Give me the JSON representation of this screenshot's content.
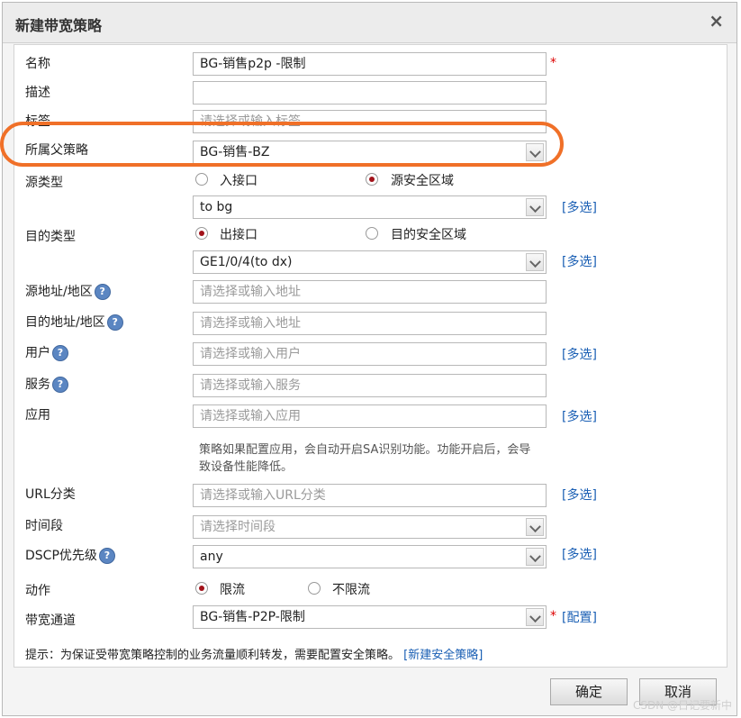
{
  "dialog": {
    "title": "新建带宽策略",
    "close_label": "×"
  },
  "fields": {
    "name": {
      "label": "名称",
      "value": "BG-销售p2p -限制",
      "required": "*"
    },
    "description": {
      "label": "描述",
      "value": ""
    },
    "tag": {
      "label": "标签",
      "placeholder": "请选择或输入标签"
    },
    "parent_policy": {
      "label": "所属父策略",
      "value": "BG-销售-BZ"
    },
    "source_type": {
      "label": "源类型",
      "option1": "入接口",
      "option2": "源安全区域",
      "selected": "源安全区域",
      "value": "to bg",
      "link": "[多选]"
    },
    "dest_type": {
      "label": "目的类型",
      "option1": "出接口",
      "option2": "目的安全区域",
      "selected": "出接口",
      "value": "GE1/0/4(to dx)",
      "link": "[多选]"
    },
    "source_address": {
      "label": "源地址/地区",
      "placeholder": "请选择或输入地址"
    },
    "dest_address": {
      "label": "目的地址/地区",
      "placeholder": "请选择或输入地址"
    },
    "user": {
      "label": "用户",
      "placeholder": "请选择或输入用户",
      "link": "[多选]"
    },
    "service": {
      "label": "服务",
      "placeholder": "请选择或输入服务"
    },
    "application": {
      "label": "应用",
      "placeholder": "请选择或输入应用",
      "link": "[多选]",
      "note": "策略如果配置应用，会自动开启SA识别功能。功能开启后，会导致设备性能降低。"
    },
    "url_category": {
      "label": "URL分类",
      "placeholder": "请选择或输入URL分类",
      "link": "[多选]"
    },
    "time_range": {
      "label": "时间段",
      "placeholder": "请选择时间段"
    },
    "dscp": {
      "label": "DSCP优先级",
      "value": "any",
      "link": "[多选]"
    },
    "action": {
      "label": "动作",
      "option1": "限流",
      "option2": "不限流",
      "selected": "限流"
    },
    "bandwidth_channel": {
      "label": "带宽通道",
      "value": "BG-销售-P2P-限制",
      "required": "*",
      "link": "[配置]"
    }
  },
  "help_icon": "?",
  "tip": {
    "text": "提示：为保证受带宽策略控制的业务流量顺利转发，需要配置安全策略。",
    "link": "[新建安全策略]"
  },
  "buttons": {
    "ok": "确定",
    "cancel": "取消"
  },
  "watermark": "CSDN @日记要新中",
  "colors": {
    "highlight": "#f07028",
    "link": "#1a5fb4",
    "required": "#dd0000",
    "radio_selected": "#a2121a"
  }
}
